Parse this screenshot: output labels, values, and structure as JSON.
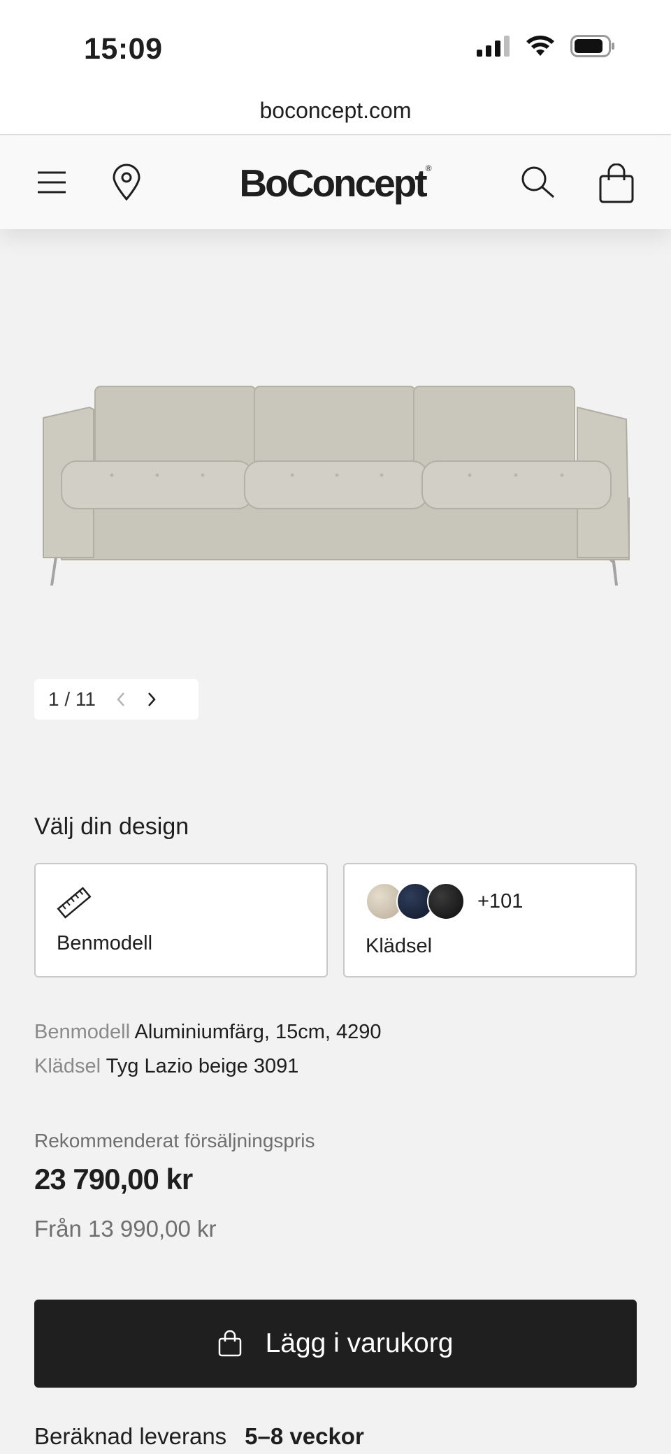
{
  "status_bar": {
    "time": "15:09"
  },
  "browser": {
    "url": "boconcept.com"
  },
  "header": {
    "logo": "BoConcept",
    "logo_mark": "®"
  },
  "gallery": {
    "counter": "1 / 11"
  },
  "design": {
    "title": "Välj din design",
    "legs_label": "Benmodell",
    "fabric_label": "Klädsel",
    "fabric_more": "+101",
    "swatch_colors": [
      "#cfc3b2",
      "#1d2a44",
      "#1b1b1b"
    ]
  },
  "specs": {
    "legs_key": "Benmodell",
    "legs_value": "Aluminiumfärg, 15cm, 4290",
    "fabric_key": "Klädsel",
    "fabric_value": "Tyg Lazio beige 3091"
  },
  "pricing": {
    "label": "Rekommenderat försäljningspris",
    "price": "23 790,00 kr",
    "from": "Från 13 990,00 kr"
  },
  "cta": {
    "add_to_cart": "Lägg i varukorg"
  },
  "delivery": {
    "label": "Beräknad leverans",
    "value": "5–8 veckor"
  },
  "colors": {
    "button": "#1f1f1f",
    "background": "#f2f2f2",
    "sofa": "#cfccc3"
  }
}
